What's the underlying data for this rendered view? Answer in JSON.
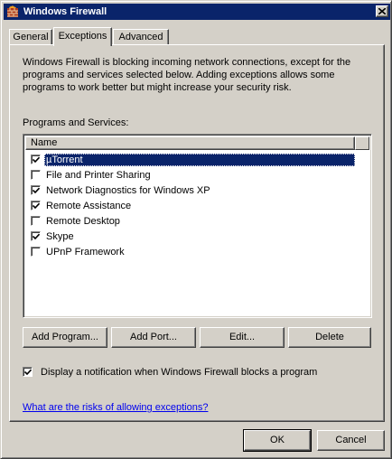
{
  "window": {
    "title": "Windows Firewall",
    "titlebar_color": "#0a246a"
  },
  "tabs": [
    {
      "label": "General",
      "active": false
    },
    {
      "label": "Exceptions",
      "active": true
    },
    {
      "label": "Advanced",
      "active": false
    }
  ],
  "intro_text": "Windows Firewall is blocking incoming network connections, except for the programs and services selected below. Adding exceptions allows some programs to work better but might increase your security risk.",
  "programs": {
    "group_label": "Programs and Services:",
    "column_header": "Name",
    "items": [
      {
        "label": "µTorrent",
        "checked": true,
        "selected": true
      },
      {
        "label": "File and Printer Sharing",
        "checked": false,
        "selected": false
      },
      {
        "label": "Network Diagnostics for Windows XP",
        "checked": true,
        "selected": false
      },
      {
        "label": "Remote Assistance",
        "checked": true,
        "selected": false
      },
      {
        "label": "Remote Desktop",
        "checked": false,
        "selected": false
      },
      {
        "label": "Skype",
        "checked": true,
        "selected": false
      },
      {
        "label": "UPnP Framework",
        "checked": false,
        "selected": false
      }
    ]
  },
  "buttons": {
    "add_program": "Add Program...",
    "add_port": "Add Port...",
    "edit": "Edit...",
    "delete": "Delete",
    "ok": "OK",
    "cancel": "Cancel"
  },
  "notification": {
    "label": "Display a notification when Windows Firewall blocks a program",
    "checked": true
  },
  "help_link": "What are the risks of allowing exceptions?",
  "icons": {
    "title_icon": "firewall-icon",
    "close": "close-icon",
    "check": "check-icon"
  }
}
